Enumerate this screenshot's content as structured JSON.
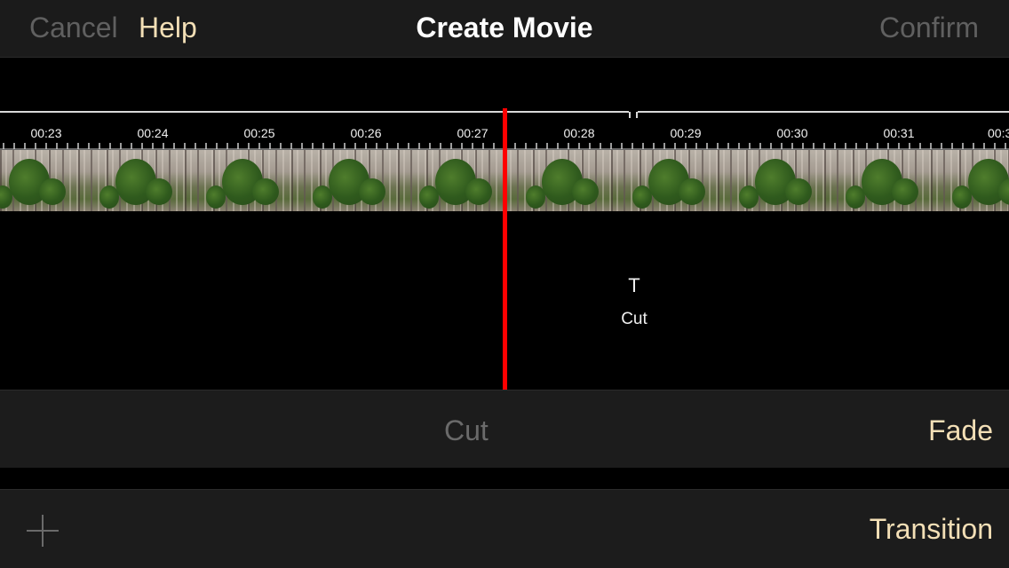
{
  "topbar": {
    "cancel_label": "Cancel",
    "help_label": "Help",
    "title": "Create Movie",
    "confirm_label": "Confirm"
  },
  "timeline": {
    "ruler_ticks": [
      "00:23",
      "00:24",
      "00:25",
      "00:26",
      "00:27",
      "00:28",
      "00:29",
      "00:30",
      "00:31",
      "00:3"
    ],
    "marker_symbol": "T",
    "marker_label": "Cut"
  },
  "transition_options": {
    "cut_label": "Cut",
    "fade_label": "Fade"
  },
  "bottombar": {
    "add_icon": "plus-icon",
    "transition_label": "Transition"
  },
  "colors": {
    "accent": "#f3dfb6",
    "disabled": "#606060",
    "playhead": "#ff0000",
    "background": "#000000",
    "bar": "#1c1c1c"
  }
}
